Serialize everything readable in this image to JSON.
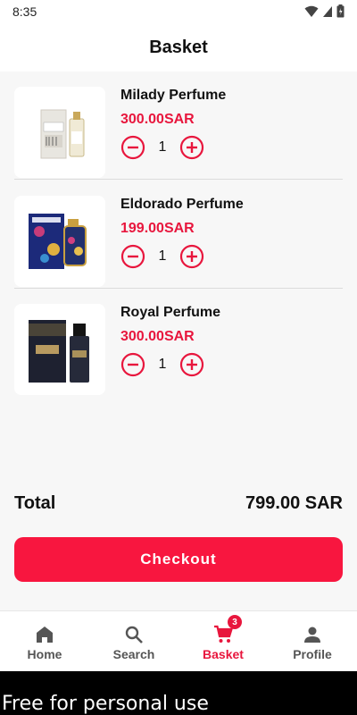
{
  "status_bar": {
    "time": "8:35"
  },
  "header": {
    "title": "Basket"
  },
  "basket": {
    "items": [
      {
        "name": "Milady Perfume",
        "price": "300.00SAR",
        "quantity": "1"
      },
      {
        "name": "Eldorado Perfume",
        "price": "199.00SAR",
        "quantity": "1"
      },
      {
        "name": "Royal Perfume",
        "price": "300.00SAR",
        "quantity": "1"
      }
    ]
  },
  "summary": {
    "total_label": "Total",
    "total_value": "799.00 SAR"
  },
  "checkout": {
    "label": "Checkout"
  },
  "bottom_nav": {
    "items": [
      {
        "label": "Home",
        "icon": "home-icon"
      },
      {
        "label": "Search",
        "icon": "search-icon"
      },
      {
        "label": "Basket",
        "icon": "cart-icon",
        "badge": "3"
      },
      {
        "label": "Profile",
        "icon": "person-icon"
      }
    ],
    "active": "Basket"
  },
  "watermark": "Free for personal use",
  "colors": {
    "accent": "#e8163d",
    "checkout_bg": "#f8163f",
    "content_bg": "#f7f7f7"
  }
}
